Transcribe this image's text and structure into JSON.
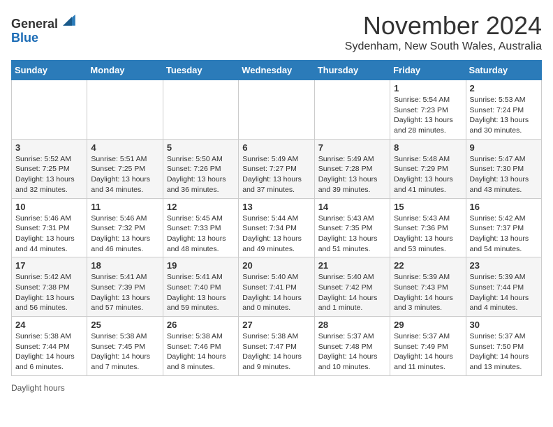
{
  "header": {
    "logo_general": "General",
    "logo_blue": "Blue",
    "month_title": "November 2024",
    "subtitle": "Sydenham, New South Wales, Australia"
  },
  "days_of_week": [
    "Sunday",
    "Monday",
    "Tuesday",
    "Wednesday",
    "Thursday",
    "Friday",
    "Saturday"
  ],
  "weeks": [
    [
      {
        "day": "",
        "info": ""
      },
      {
        "day": "",
        "info": ""
      },
      {
        "day": "",
        "info": ""
      },
      {
        "day": "",
        "info": ""
      },
      {
        "day": "",
        "info": ""
      },
      {
        "day": "1",
        "info": "Sunrise: 5:54 AM\nSunset: 7:23 PM\nDaylight: 13 hours and 28 minutes."
      },
      {
        "day": "2",
        "info": "Sunrise: 5:53 AM\nSunset: 7:24 PM\nDaylight: 13 hours and 30 minutes."
      }
    ],
    [
      {
        "day": "3",
        "info": "Sunrise: 5:52 AM\nSunset: 7:25 PM\nDaylight: 13 hours and 32 minutes."
      },
      {
        "day": "4",
        "info": "Sunrise: 5:51 AM\nSunset: 7:25 PM\nDaylight: 13 hours and 34 minutes."
      },
      {
        "day": "5",
        "info": "Sunrise: 5:50 AM\nSunset: 7:26 PM\nDaylight: 13 hours and 36 minutes."
      },
      {
        "day": "6",
        "info": "Sunrise: 5:49 AM\nSunset: 7:27 PM\nDaylight: 13 hours and 37 minutes."
      },
      {
        "day": "7",
        "info": "Sunrise: 5:49 AM\nSunset: 7:28 PM\nDaylight: 13 hours and 39 minutes."
      },
      {
        "day": "8",
        "info": "Sunrise: 5:48 AM\nSunset: 7:29 PM\nDaylight: 13 hours and 41 minutes."
      },
      {
        "day": "9",
        "info": "Sunrise: 5:47 AM\nSunset: 7:30 PM\nDaylight: 13 hours and 43 minutes."
      }
    ],
    [
      {
        "day": "10",
        "info": "Sunrise: 5:46 AM\nSunset: 7:31 PM\nDaylight: 13 hours and 44 minutes."
      },
      {
        "day": "11",
        "info": "Sunrise: 5:46 AM\nSunset: 7:32 PM\nDaylight: 13 hours and 46 minutes."
      },
      {
        "day": "12",
        "info": "Sunrise: 5:45 AM\nSunset: 7:33 PM\nDaylight: 13 hours and 48 minutes."
      },
      {
        "day": "13",
        "info": "Sunrise: 5:44 AM\nSunset: 7:34 PM\nDaylight: 13 hours and 49 minutes."
      },
      {
        "day": "14",
        "info": "Sunrise: 5:43 AM\nSunset: 7:35 PM\nDaylight: 13 hours and 51 minutes."
      },
      {
        "day": "15",
        "info": "Sunrise: 5:43 AM\nSunset: 7:36 PM\nDaylight: 13 hours and 53 minutes."
      },
      {
        "day": "16",
        "info": "Sunrise: 5:42 AM\nSunset: 7:37 PM\nDaylight: 13 hours and 54 minutes."
      }
    ],
    [
      {
        "day": "17",
        "info": "Sunrise: 5:42 AM\nSunset: 7:38 PM\nDaylight: 13 hours and 56 minutes."
      },
      {
        "day": "18",
        "info": "Sunrise: 5:41 AM\nSunset: 7:39 PM\nDaylight: 13 hours and 57 minutes."
      },
      {
        "day": "19",
        "info": "Sunrise: 5:41 AM\nSunset: 7:40 PM\nDaylight: 13 hours and 59 minutes."
      },
      {
        "day": "20",
        "info": "Sunrise: 5:40 AM\nSunset: 7:41 PM\nDaylight: 14 hours and 0 minutes."
      },
      {
        "day": "21",
        "info": "Sunrise: 5:40 AM\nSunset: 7:42 PM\nDaylight: 14 hours and 1 minute."
      },
      {
        "day": "22",
        "info": "Sunrise: 5:39 AM\nSunset: 7:43 PM\nDaylight: 14 hours and 3 minutes."
      },
      {
        "day": "23",
        "info": "Sunrise: 5:39 AM\nSunset: 7:44 PM\nDaylight: 14 hours and 4 minutes."
      }
    ],
    [
      {
        "day": "24",
        "info": "Sunrise: 5:38 AM\nSunset: 7:44 PM\nDaylight: 14 hours and 6 minutes."
      },
      {
        "day": "25",
        "info": "Sunrise: 5:38 AM\nSunset: 7:45 PM\nDaylight: 14 hours and 7 minutes."
      },
      {
        "day": "26",
        "info": "Sunrise: 5:38 AM\nSunset: 7:46 PM\nDaylight: 14 hours and 8 minutes."
      },
      {
        "day": "27",
        "info": "Sunrise: 5:38 AM\nSunset: 7:47 PM\nDaylight: 14 hours and 9 minutes."
      },
      {
        "day": "28",
        "info": "Sunrise: 5:37 AM\nSunset: 7:48 PM\nDaylight: 14 hours and 10 minutes."
      },
      {
        "day": "29",
        "info": "Sunrise: 5:37 AM\nSunset: 7:49 PM\nDaylight: 14 hours and 11 minutes."
      },
      {
        "day": "30",
        "info": "Sunrise: 5:37 AM\nSunset: 7:50 PM\nDaylight: 14 hours and 13 minutes."
      }
    ]
  ],
  "footer": {
    "daylight_label": "Daylight hours"
  }
}
